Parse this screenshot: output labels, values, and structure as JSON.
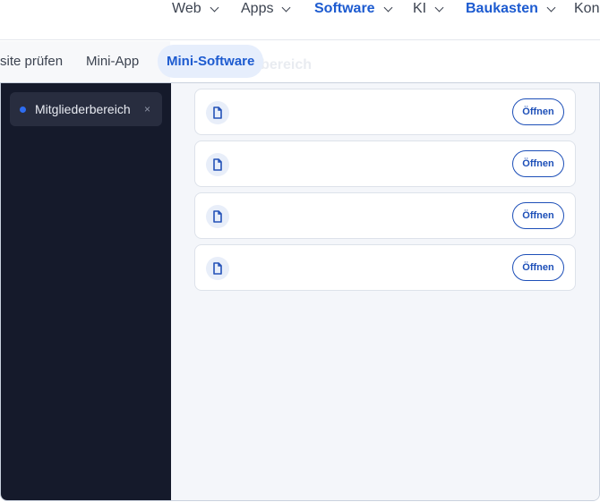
{
  "nav": {
    "items": [
      {
        "label": "Web",
        "active": false
      },
      {
        "label": "Apps",
        "active": false
      },
      {
        "label": "Software",
        "active": true
      },
      {
        "label": "KI",
        "active": false
      },
      {
        "label": "Baukasten",
        "active": true
      },
      {
        "label": "Kon",
        "active": false
      }
    ]
  },
  "subtabs": {
    "items": [
      {
        "label": "site prüfen"
      },
      {
        "label": "Mini-App"
      },
      {
        "label": "Mini-Software",
        "active": true
      }
    ],
    "ghost_title": "erbereich"
  },
  "sidebar": {
    "tab": {
      "label": "Mitgliederbereich",
      "close": "×"
    }
  },
  "files": {
    "items": [
      {
        "button": "Öffnen"
      },
      {
        "button": "Öffnen"
      },
      {
        "button": "Öffnen"
      },
      {
        "button": "Öffnen"
      }
    ]
  },
  "colors": {
    "accent": "#1d5bd0",
    "sidebar_bg": "#151a2b",
    "content_bg": "#f4f6fa"
  }
}
